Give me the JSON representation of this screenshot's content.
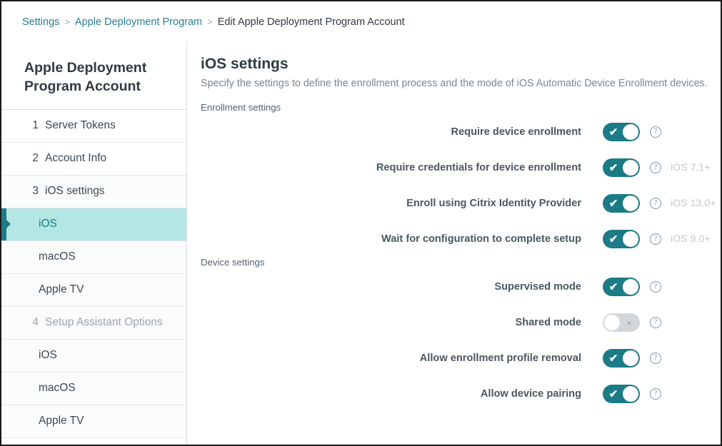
{
  "breadcrumb": {
    "items": [
      {
        "label": "Settings",
        "type": "link"
      },
      {
        "label": "Apple Deployment Program",
        "type": "link"
      },
      {
        "label": "Edit Apple Deployment Program Account",
        "type": "current"
      }
    ],
    "separator": ">"
  },
  "sidebar": {
    "title": "Apple Deployment Program Account",
    "items": [
      {
        "step": "1",
        "label": "Server Tokens",
        "child": false,
        "active": false,
        "disabled": false,
        "shaded": false
      },
      {
        "step": "2",
        "label": "Account Info",
        "child": false,
        "active": false,
        "disabled": false,
        "shaded": false
      },
      {
        "step": "3",
        "label": "iOS settings",
        "child": false,
        "active": false,
        "disabled": false,
        "shaded": true
      },
      {
        "step": "",
        "label": "iOS",
        "child": true,
        "active": true,
        "disabled": false,
        "shaded": false
      },
      {
        "step": "",
        "label": "macOS",
        "child": true,
        "active": false,
        "disabled": false,
        "shaded": true
      },
      {
        "step": "",
        "label": "Apple TV",
        "child": true,
        "active": false,
        "disabled": false,
        "shaded": true
      },
      {
        "step": "4",
        "label": "Setup Assistant Options",
        "child": false,
        "active": false,
        "disabled": true,
        "shaded": true
      },
      {
        "step": "",
        "label": "iOS",
        "child": true,
        "active": false,
        "disabled": false,
        "shaded": true
      },
      {
        "step": "",
        "label": "macOS",
        "child": true,
        "active": false,
        "disabled": false,
        "shaded": true
      },
      {
        "step": "",
        "label": "Apple TV",
        "child": true,
        "active": false,
        "disabled": false,
        "shaded": true
      }
    ]
  },
  "content": {
    "title": "iOS settings",
    "description": "Specify the settings to define the enrollment process and the mode of iOS Automatic Device Enrollment devices.",
    "sections": [
      {
        "label": "Enrollment settings",
        "rows": [
          {
            "label": "Require device enrollment",
            "state": "on",
            "help": "?",
            "version": ""
          },
          {
            "label": "Require credentials for device enrollment",
            "state": "on",
            "help": "?",
            "version": "iOS 7.1+"
          },
          {
            "label": "Enroll using Citrix Identity Provider",
            "state": "on",
            "help": "?",
            "version": "iOS 13.0+"
          },
          {
            "label": "Wait for configuration to complete setup",
            "state": "on",
            "help": "?",
            "version": "iOS 9.0+"
          }
        ]
      },
      {
        "label": "Device settings",
        "rows": [
          {
            "label": "Supervised mode",
            "state": "on",
            "help": "?",
            "version": ""
          },
          {
            "label": "Shared mode",
            "state": "off",
            "help": "?",
            "version": ""
          },
          {
            "label": "Allow enrollment profile removal",
            "state": "on",
            "help": "?",
            "version": ""
          },
          {
            "label": "Allow device pairing",
            "state": "on",
            "help": "?",
            "version": ""
          }
        ]
      }
    ],
    "toggle_glyphs": {
      "on": "✔",
      "off": "×"
    }
  },
  "colors": {
    "accent_teal": "#1b7b86",
    "active_bg": "#b4e6e3",
    "link": "#2a7f95",
    "muted": "#c3c8cb"
  }
}
